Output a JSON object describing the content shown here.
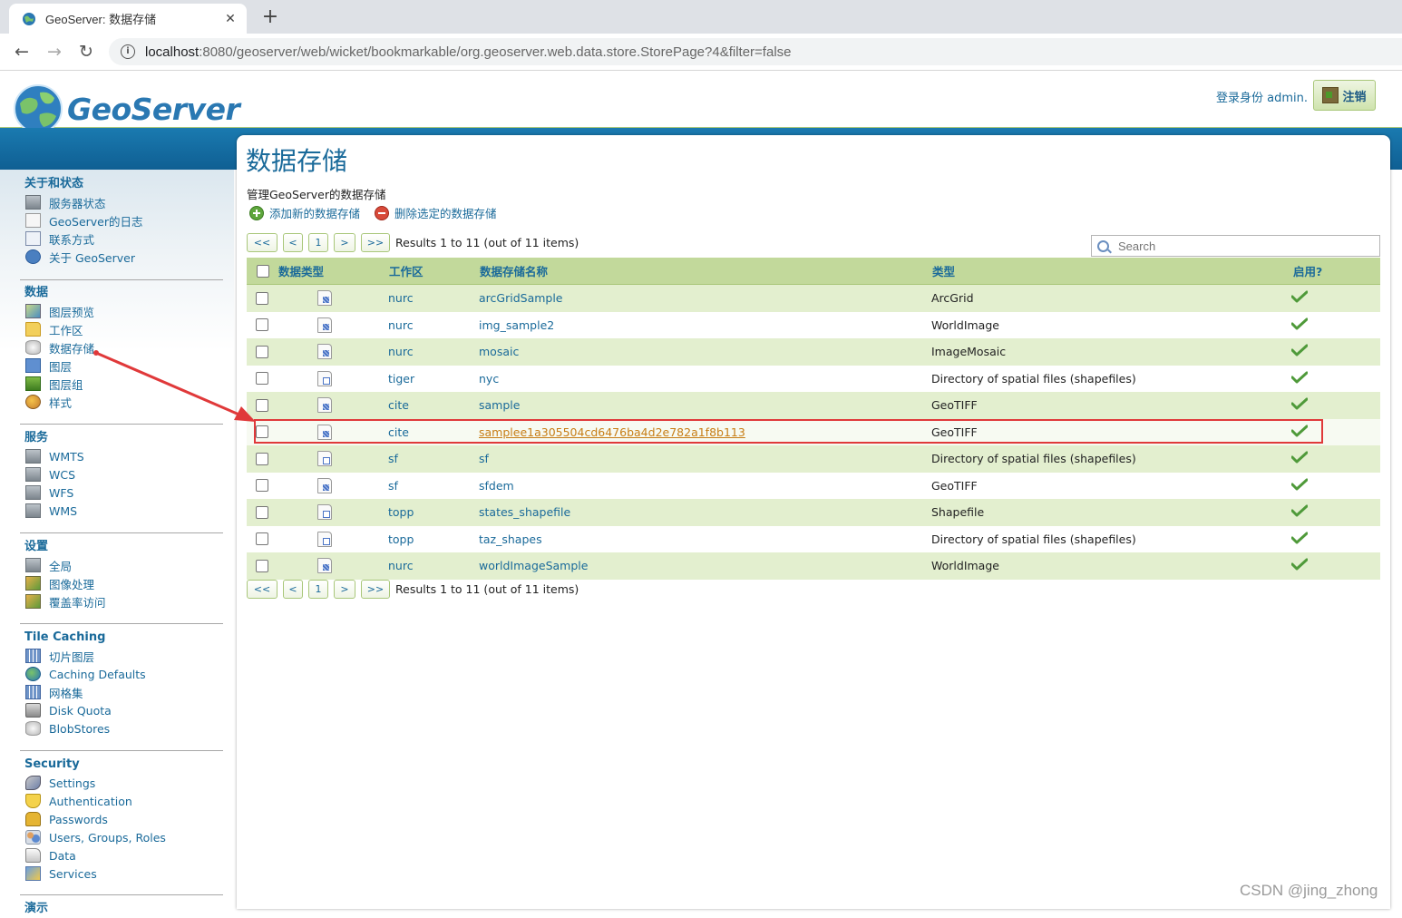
{
  "browser": {
    "tab_title": "GeoServer: 数据存储",
    "tab_close": "✕",
    "new_tab": "+",
    "back": "←",
    "forward": "→",
    "reload": "↻",
    "url_host": "localhost",
    "url_rest": ":8080/geoserver/web/wicket/bookmarkable/org.geoserver.web.data.store.StorePage?4&filter=false"
  },
  "header": {
    "logo_text": "GeoServer",
    "login_text": "登录身份 admin.",
    "logout_label": "注销"
  },
  "sidebar": {
    "sections": [
      {
        "title": "关于和状态",
        "items": [
          "服务器状态",
          "GeoServer的日志",
          "联系方式",
          "关于 GeoServer"
        ]
      },
      {
        "title": "数据",
        "items": [
          "图层预览",
          "工作区",
          "数据存储",
          "图层",
          "图层组",
          "样式"
        ]
      },
      {
        "title": "服务",
        "items": [
          "WMTS",
          "WCS",
          "WFS",
          "WMS"
        ]
      },
      {
        "title": "设置",
        "items": [
          "全局",
          "图像处理",
          "覆盖率访问"
        ]
      },
      {
        "title": "Tile Caching",
        "items": [
          "切片图层",
          "Caching Defaults",
          "网格集",
          "Disk Quota",
          "BlobStores"
        ]
      },
      {
        "title": "Security",
        "items": [
          "Settings",
          "Authentication",
          "Passwords",
          "Users, Groups, Roles",
          "Data",
          "Services"
        ]
      },
      {
        "title": "演示",
        "items": []
      }
    ]
  },
  "page": {
    "title": "数据存储",
    "description": "管理GeoServer的数据存储",
    "add_label": "添加新的数据存储",
    "remove_label": "删除选定的数据存储",
    "search_placeholder": "Search"
  },
  "pager": {
    "first": "<<",
    "prev": "<",
    "page": "1",
    "next": ">",
    "last": ">>",
    "info": "Results 1 to 11 (out of 11 items)"
  },
  "table": {
    "headers": [
      "数据类型",
      "工作区",
      "数据存储名称",
      "类型",
      "启用?"
    ],
    "rows": [
      {
        "workspace": "nurc",
        "name": "arcGridSample",
        "type": "ArcGrid",
        "kind": "raster"
      },
      {
        "workspace": "nurc",
        "name": "img_sample2",
        "type": "WorldImage",
        "kind": "raster"
      },
      {
        "workspace": "nurc",
        "name": "mosaic",
        "type": "ImageMosaic",
        "kind": "raster"
      },
      {
        "workspace": "tiger",
        "name": "nyc",
        "type": "Directory of spatial files (shapefiles)",
        "kind": "vector"
      },
      {
        "workspace": "cite",
        "name": "sample",
        "type": "GeoTIFF",
        "kind": "raster"
      },
      {
        "workspace": "cite",
        "name": "samplee1a305504cd6476ba4d2e782a1f8b113",
        "type": "GeoTIFF",
        "kind": "raster"
      },
      {
        "workspace": "sf",
        "name": "sf",
        "type": "Directory of spatial files (shapefiles)",
        "kind": "vector"
      },
      {
        "workspace": "sf",
        "name": "sfdem",
        "type": "GeoTIFF",
        "kind": "raster"
      },
      {
        "workspace": "topp",
        "name": "states_shapefile",
        "type": "Shapefile",
        "kind": "vector"
      },
      {
        "workspace": "topp",
        "name": "taz_shapes",
        "type": "Directory of spatial files (shapefiles)",
        "kind": "vector"
      },
      {
        "workspace": "nurc",
        "name": "worldImageSample",
        "type": "WorldImage",
        "kind": "raster"
      }
    ]
  },
  "watermark": "CSDN @jing_zhong",
  "colors": {
    "link": "#1a6a9a",
    "header_band": "#1a7ab0",
    "row_alt": "#e3efcf",
    "table_head": "#c2d99b",
    "annotation": "#e0393a"
  }
}
